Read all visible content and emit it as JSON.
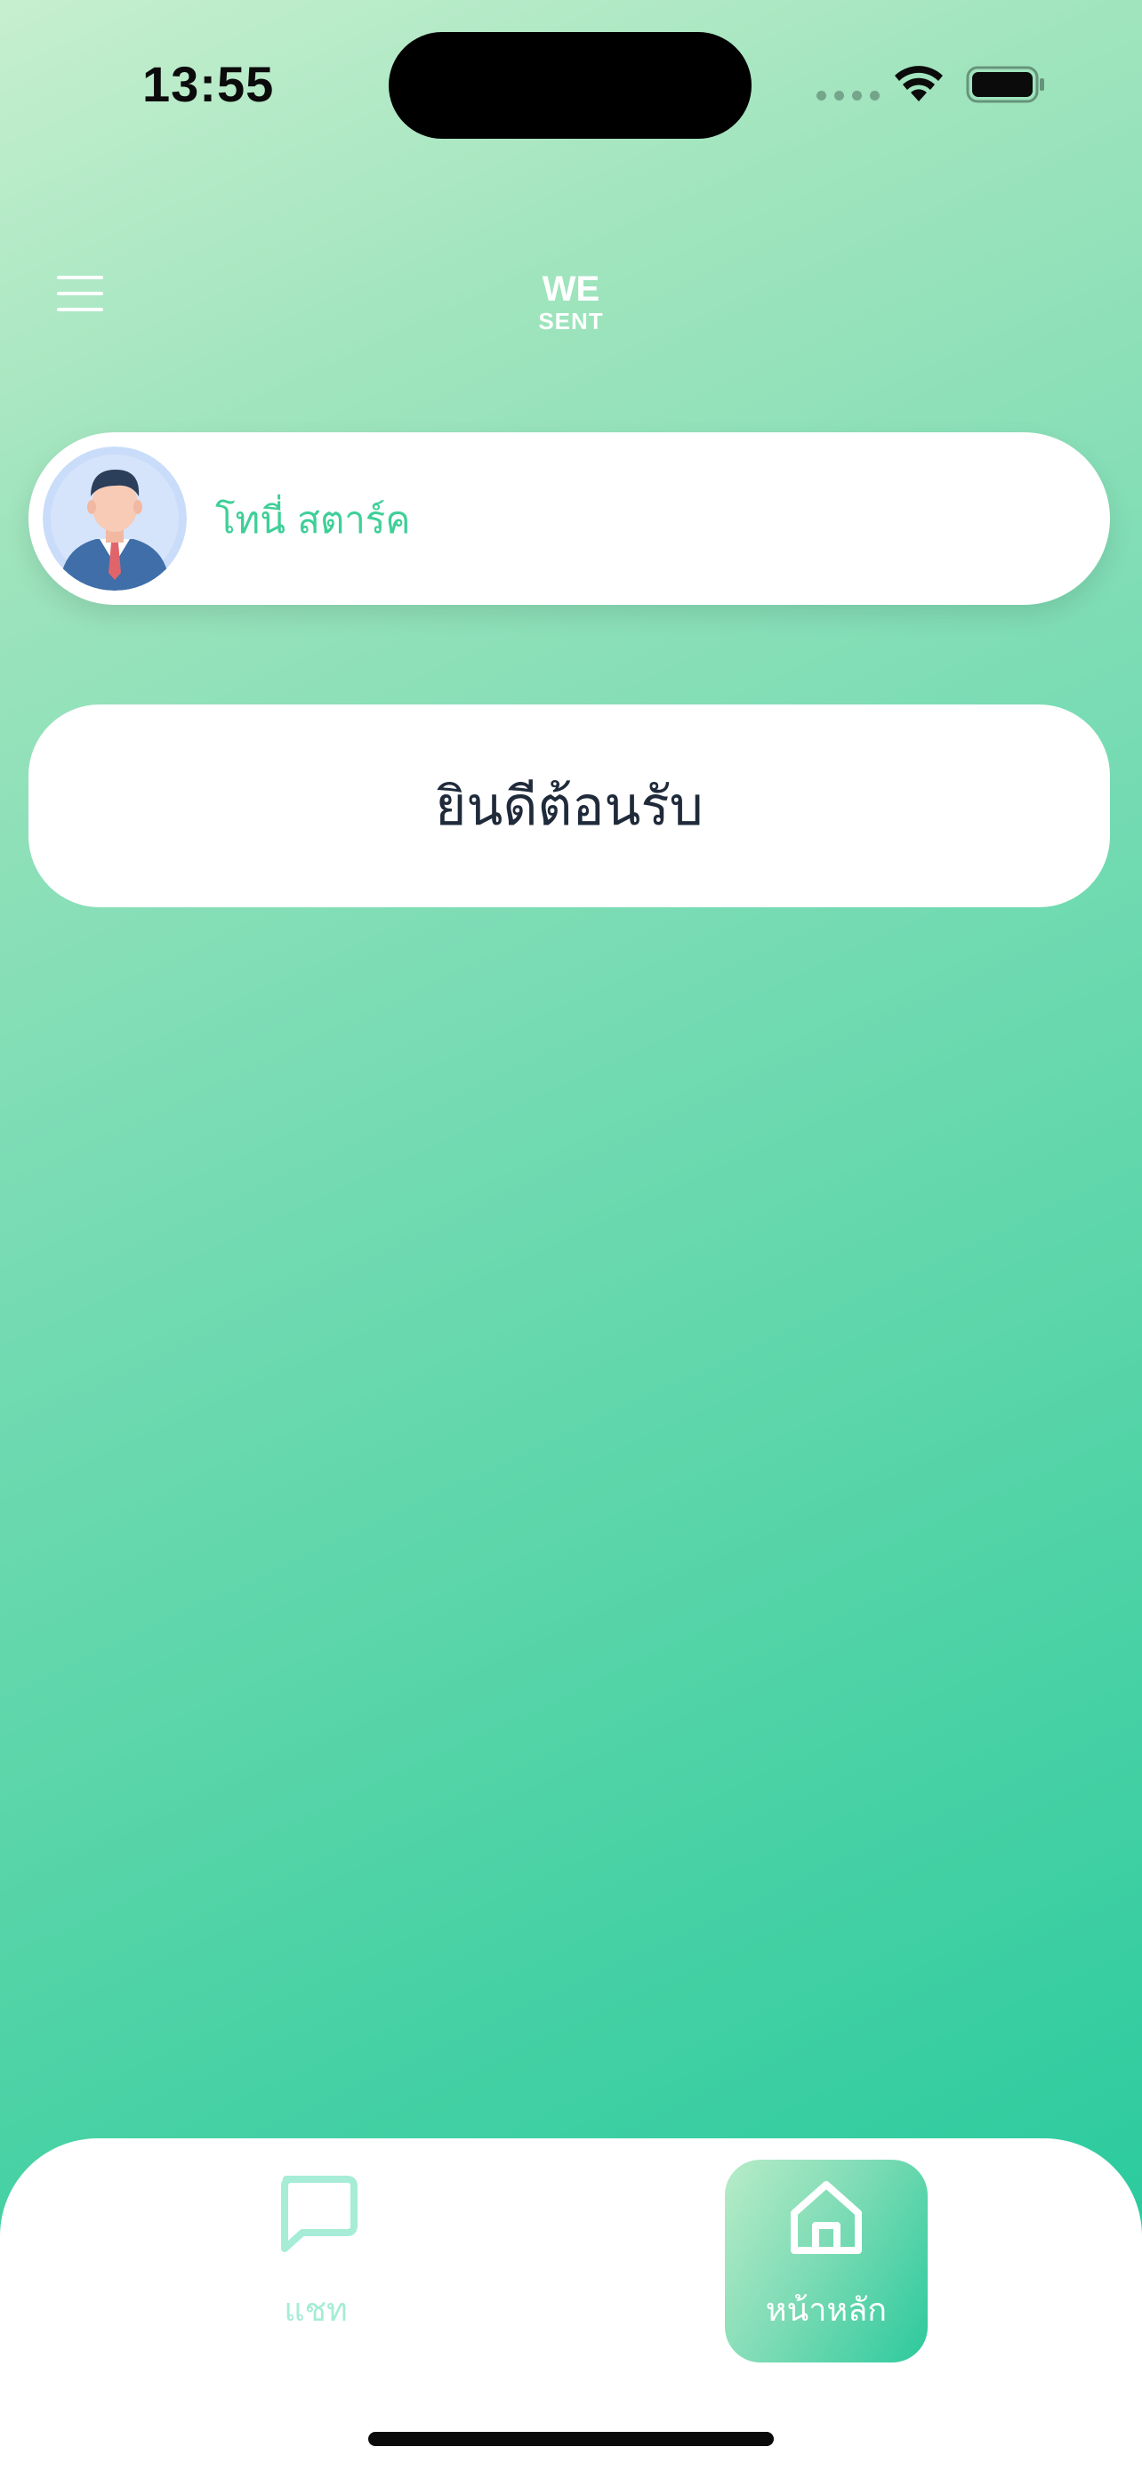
{
  "status_bar": {
    "time": "13:55",
    "icons": [
      "signal-dots-icon",
      "wifi-icon",
      "battery-icon"
    ]
  },
  "header": {
    "menu_icon": "hamburger-menu-icon",
    "logo": {
      "line1": "WE",
      "line2": "SENT"
    }
  },
  "profile": {
    "name": "โทนี่ สตาร์ค",
    "avatar_icon": "businessman-avatar"
  },
  "welcome": {
    "text": "ยินดีต้อนรับ"
  },
  "tab_bar": {
    "tabs": [
      {
        "label": "แชท",
        "icon": "chat-bubble-icon",
        "active": false
      },
      {
        "label": "หน้าหลัก",
        "icon": "home-icon",
        "active": true
      }
    ]
  },
  "colors": {
    "accent_green": "#3ecf98",
    "gradient_start": "#c6efcf",
    "gradient_end": "#1fc89c",
    "welcome_text": "#1f2a3a",
    "inactive_tab": "#a6ecd6"
  }
}
